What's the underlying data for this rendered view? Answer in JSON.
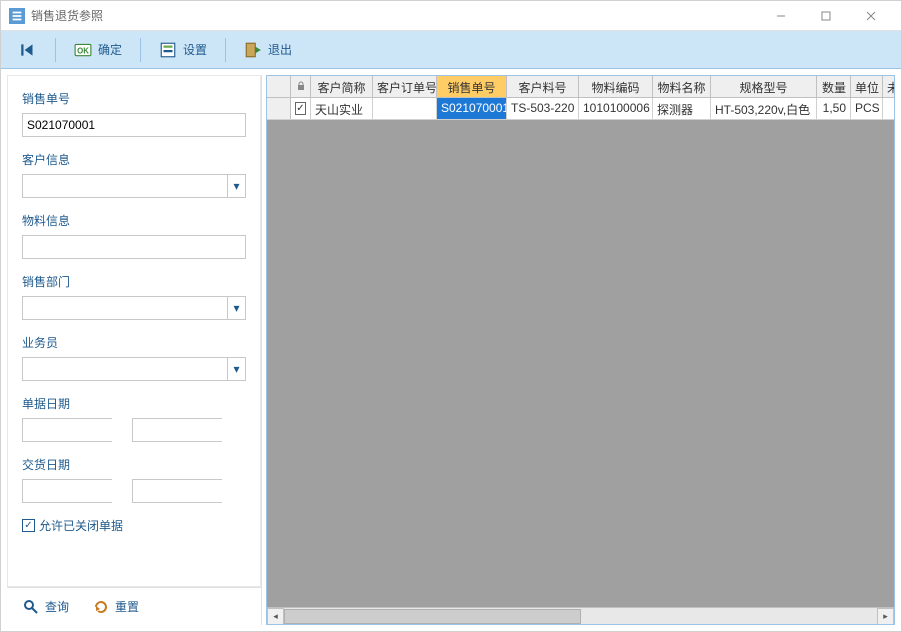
{
  "window_title": "销售退货参照",
  "toolbar": {
    "first_label": "",
    "ok_label": "确定",
    "settings_label": "设置",
    "exit_label": "退出"
  },
  "sidebar": {
    "sales_no": {
      "label": "销售单号",
      "value": "S021070001"
    },
    "customer_info": {
      "label": "客户信息",
      "value": ""
    },
    "material_info": {
      "label": "物料信息",
      "value": ""
    },
    "sales_dept": {
      "label": "销售部门",
      "value": ""
    },
    "salesman": {
      "label": "业务员",
      "value": ""
    },
    "doc_date": {
      "label": "单据日期",
      "from": "",
      "to": ""
    },
    "delivery_date": {
      "label": "交货日期",
      "from": "",
      "to": ""
    },
    "allow_closed": {
      "label": "允许已关闭单据",
      "checked": true
    },
    "footer": {
      "search_label": "查询",
      "reset_label": "重置"
    },
    "date_separator": "-"
  },
  "grid": {
    "columns": {
      "cust_short": "客户简称",
      "cust_order": "客户订单号",
      "sales_no": "销售单号",
      "cust_mat": "客户料号",
      "mat_code": "物料编码",
      "mat_name": "物料名称",
      "spec": "规格型号",
      "qty": "数量",
      "unit": "单位",
      "unsent": "未发"
    },
    "rows": [
      {
        "checked": true,
        "cust_short": "天山实业",
        "cust_order": "",
        "sales_no": "S021070001",
        "cust_mat": "TS-503-220",
        "mat_code": "1010100006",
        "mat_name": "探测器",
        "spec": "HT-503,220v,白色",
        "qty": "1,50",
        "unit": "PCS",
        "unsent": ""
      }
    ]
  }
}
